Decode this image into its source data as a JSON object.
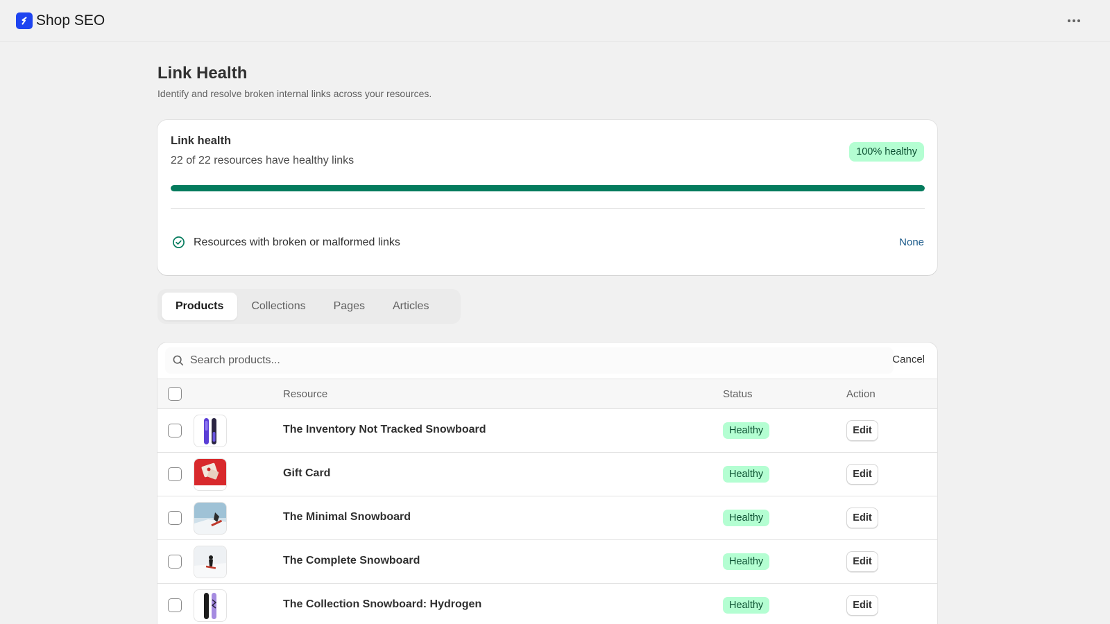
{
  "app": {
    "name": "Shop SEO",
    "logo_icon": "shopify-s-icon",
    "brand_color": "#1e44f0"
  },
  "header": {
    "title": "Link Health",
    "subtitle": "Identify and resolve broken internal links across your resources."
  },
  "health_card": {
    "title": "Link health",
    "summary": "22 of 22 resources have healthy links",
    "badge": "100% healthy",
    "progress_fraction": 1.0,
    "progress_color": "#047b5d",
    "broken_label": "Resources with broken or malformed links",
    "broken_value": "None"
  },
  "tabs": [
    {
      "label": "Products",
      "active": true
    },
    {
      "label": "Collections",
      "active": false
    },
    {
      "label": "Pages",
      "active": false
    },
    {
      "label": "Articles",
      "active": false
    }
  ],
  "search": {
    "placeholder": "Search products...",
    "value": "",
    "cancel_label": "Cancel"
  },
  "table": {
    "columns": {
      "resource": "Resource",
      "status": "Status",
      "action": "Action"
    },
    "rows": [
      {
        "name": "The Inventory Not Tracked Snowboard",
        "status": "Healthy",
        "action": "Edit",
        "thumb": "snowboard-purple"
      },
      {
        "name": "Gift Card",
        "status": "Healthy",
        "action": "Edit",
        "thumb": "gift-card-red"
      },
      {
        "name": "The Minimal Snowboard",
        "status": "Healthy",
        "action": "Edit",
        "thumb": "snowboarder-jump"
      },
      {
        "name": "The Complete Snowboard",
        "status": "Healthy",
        "action": "Edit",
        "thumb": "snowboarder-snow"
      },
      {
        "name": "The Collection Snowboard: Hydrogen",
        "status": "Healthy",
        "action": "Edit",
        "thumb": "snowboard-black-purple"
      }
    ]
  },
  "colors": {
    "healthy_badge_bg": "#b4fed2",
    "healthy_badge_text": "#0c5132"
  }
}
